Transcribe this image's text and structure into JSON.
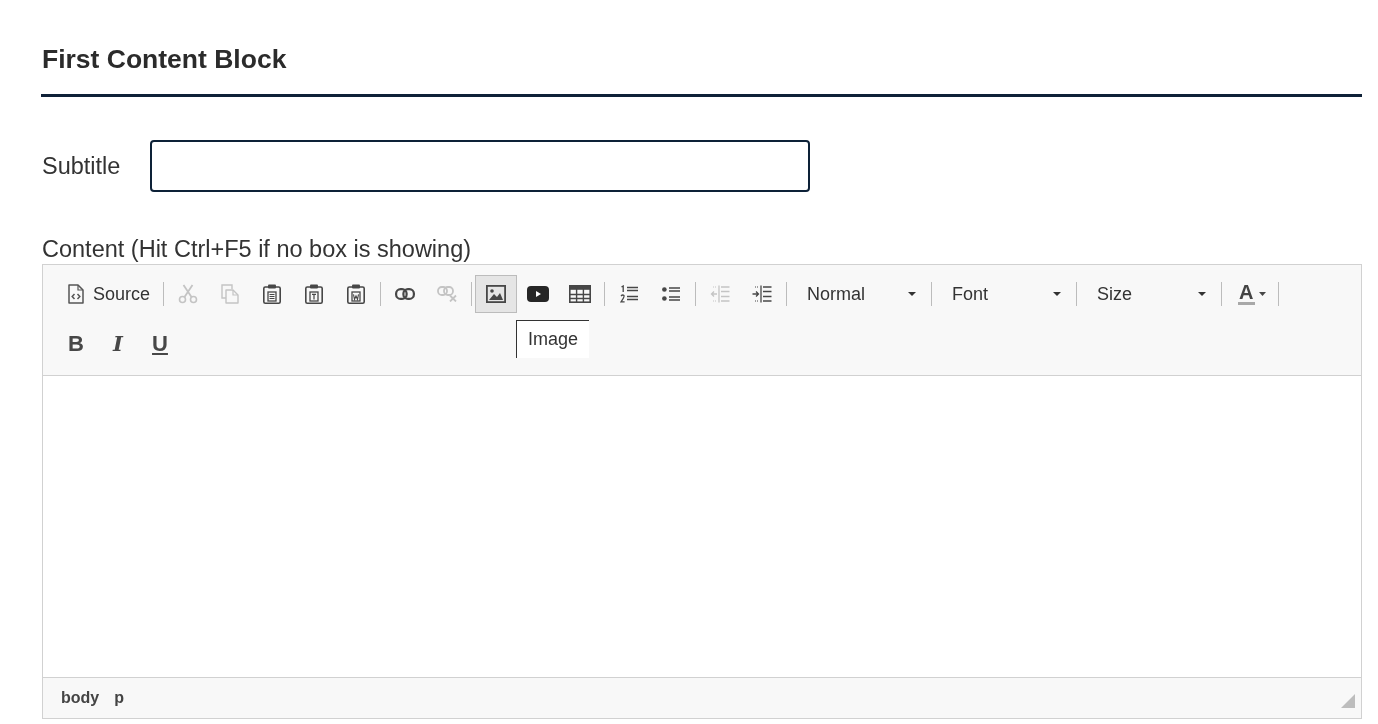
{
  "section": {
    "title": "First Content Block"
  },
  "subtitle": {
    "label": "Subtitle"
  },
  "content": {
    "label": "Content (Hit Ctrl+F5 if no box is showing)"
  },
  "editor": {
    "toolbar_rows": [
      [
        {
          "kind": "source",
          "label": "Source",
          "disabled": false,
          "hovered": false
        },
        {
          "kind": "separator"
        },
        {
          "kind": "cut",
          "disabled": true,
          "hovered": false
        },
        {
          "kind": "copy",
          "disabled": true,
          "hovered": false
        },
        {
          "kind": "paste",
          "disabled": false,
          "hovered": false
        },
        {
          "kind": "paste-text",
          "disabled": false,
          "hovered": false
        },
        {
          "kind": "paste-word",
          "disabled": false,
          "hovered": false
        },
        {
          "kind": "separator"
        },
        {
          "kind": "link",
          "disabled": false,
          "hovered": false
        },
        {
          "kind": "unlink",
          "disabled": true,
          "hovered": false
        },
        {
          "kind": "separator"
        },
        {
          "kind": "image",
          "disabled": false,
          "hovered": true
        },
        {
          "kind": "video",
          "disabled": false,
          "hovered": false
        },
        {
          "kind": "table",
          "disabled": false,
          "hovered": false
        },
        {
          "kind": "separator"
        },
        {
          "kind": "numbered-list",
          "disabled": false,
          "hovered": false
        },
        {
          "kind": "bulleted-list",
          "disabled": false,
          "hovered": false
        },
        {
          "kind": "separator"
        },
        {
          "kind": "outdent",
          "disabled": true,
          "hovered": false
        },
        {
          "kind": "indent",
          "disabled": false,
          "hovered": false
        },
        {
          "kind": "separator"
        },
        {
          "kind": "combo",
          "label": "Normal",
          "disabled": false,
          "hovered": false
        },
        {
          "kind": "separator"
        },
        {
          "kind": "combo",
          "label": "Font",
          "disabled": false,
          "hovered": false
        },
        {
          "kind": "separator"
        },
        {
          "kind": "combo",
          "label": "Size",
          "disabled": false,
          "hovered": false
        },
        {
          "kind": "separator"
        },
        {
          "kind": "text-color",
          "label": "A",
          "disabled": false,
          "hovered": false
        },
        {
          "kind": "separator"
        }
      ],
      [
        {
          "kind": "bold",
          "label": "B",
          "disabled": false,
          "hovered": false
        },
        {
          "kind": "italic",
          "label": "I",
          "disabled": false,
          "hovered": false
        },
        {
          "kind": "underline",
          "label": "U",
          "disabled": false,
          "hovered": false
        }
      ]
    ],
    "tooltip": "Image",
    "element_path": [
      "body",
      "p"
    ]
  }
}
